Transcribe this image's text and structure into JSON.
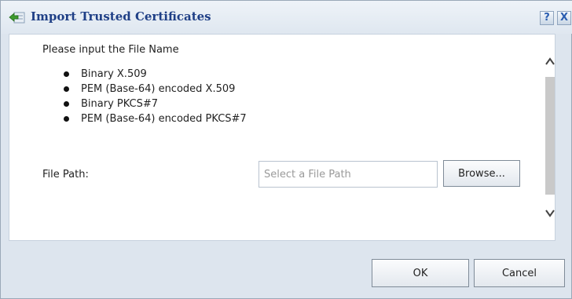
{
  "dialog": {
    "title": "Import Trusted Certificates",
    "help_label": "?",
    "close_label": "X",
    "title_icon": "import-certificate-icon"
  },
  "content": {
    "prompt": "Please input the File Name",
    "formats": [
      "Binary X.509",
      "PEM (Base-64) encoded X.509",
      "Binary PKCS#7",
      "PEM (Base-64) encoded PKCS#7"
    ],
    "file_path_label": "File Path:",
    "file_path_value": "",
    "file_path_placeholder": "Select a File Path",
    "browse_label": "Browse..."
  },
  "footer": {
    "ok_label": "OK",
    "cancel_label": "Cancel"
  }
}
